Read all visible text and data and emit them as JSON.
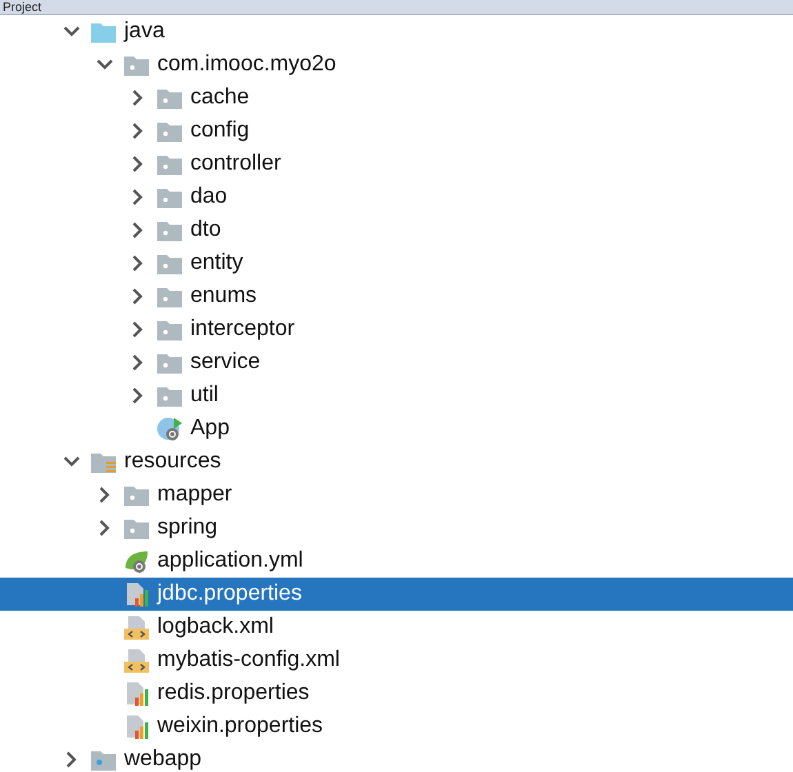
{
  "panel": {
    "title": "Project"
  },
  "tree": [
    {
      "label": "java",
      "kind": "source-folder",
      "expanded": true,
      "selected": false,
      "children": [
        {
          "label": "com.imooc.myo2o",
          "kind": "package",
          "expanded": true,
          "selected": false,
          "children": [
            {
              "label": "cache",
              "kind": "package",
              "expanded": false,
              "selected": false
            },
            {
              "label": "config",
              "kind": "package",
              "expanded": false,
              "selected": false
            },
            {
              "label": "controller",
              "kind": "package",
              "expanded": false,
              "selected": false
            },
            {
              "label": "dao",
              "kind": "package",
              "expanded": false,
              "selected": false
            },
            {
              "label": "dto",
              "kind": "package",
              "expanded": false,
              "selected": false
            },
            {
              "label": "entity",
              "kind": "package",
              "expanded": false,
              "selected": false
            },
            {
              "label": "enums",
              "kind": "package",
              "expanded": false,
              "selected": false
            },
            {
              "label": "interceptor",
              "kind": "package",
              "expanded": false,
              "selected": false
            },
            {
              "label": "service",
              "kind": "package",
              "expanded": false,
              "selected": false
            },
            {
              "label": "util",
              "kind": "package",
              "expanded": false,
              "selected": false
            },
            {
              "label": "App",
              "kind": "class",
              "selected": false
            }
          ]
        }
      ]
    },
    {
      "label": "resources",
      "kind": "resources-folder",
      "expanded": true,
      "selected": false,
      "children": [
        {
          "label": "mapper",
          "kind": "package",
          "expanded": false,
          "selected": false
        },
        {
          "label": "spring",
          "kind": "package",
          "expanded": false,
          "selected": false
        },
        {
          "label": "application.yml",
          "kind": "yml",
          "selected": false
        },
        {
          "label": "jdbc.properties",
          "kind": "properties",
          "selected": true
        },
        {
          "label": "logback.xml",
          "kind": "xml",
          "selected": false
        },
        {
          "label": "mybatis-config.xml",
          "kind": "xml",
          "selected": false
        },
        {
          "label": "redis.properties",
          "kind": "properties",
          "selected": false
        },
        {
          "label": "weixin.properties",
          "kind": "properties",
          "selected": false
        }
      ]
    },
    {
      "label": "webapp",
      "kind": "web-folder",
      "expanded": false,
      "selected": false
    }
  ]
}
